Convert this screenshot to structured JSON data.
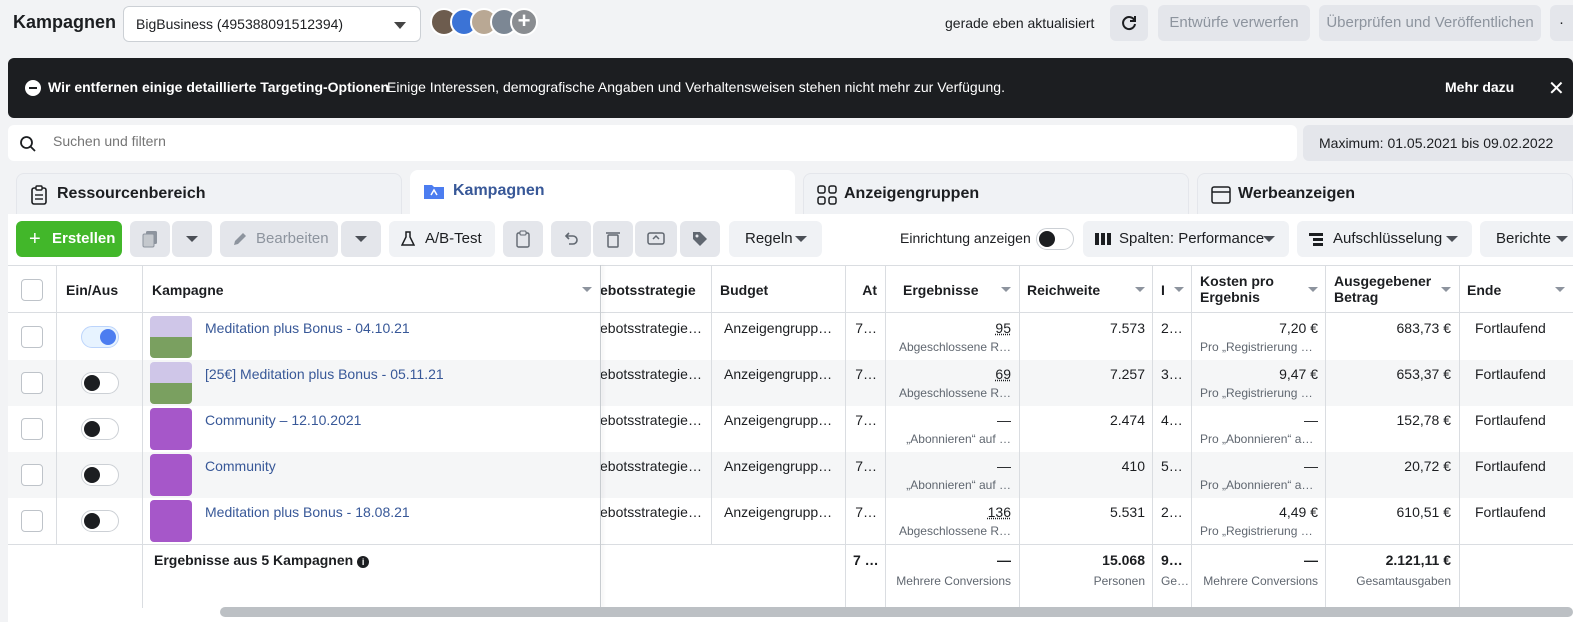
{
  "header": {
    "title": "Kampagnen",
    "account": "BigBusiness (495388091512394)",
    "updated": "gerade eben aktualisiert",
    "discard": "Entwürfe verwerfen",
    "review": "Überprüfen und Veröffentlichen"
  },
  "banner": {
    "title": "Wir entfernen einige detaillierte Targeting-Optionen",
    "text": "Einige Interessen, demografische Angaben und Verhaltensweisen stehen nicht mehr zur Verfügung.",
    "more": "Mehr dazu"
  },
  "search": {
    "placeholder": "Suchen und filtern"
  },
  "daterange": "Maximum: 01.05.2021 bis 09.02.2022",
  "tabs": [
    {
      "label": "Ressourcenbereich"
    },
    {
      "label": "Kampagnen"
    },
    {
      "label": "Anzeigengruppen"
    },
    {
      "label": "Werbeanzeigen"
    }
  ],
  "toolbar": {
    "create": "Erstellen",
    "edit": "Bearbeiten",
    "abtest": "A/B-Test",
    "rules": "Regeln",
    "setup": "Einrichtung anzeigen",
    "columns": "Spalten: Performance",
    "breakdown": "Aufschlüsselung",
    "reports": "Berichte"
  },
  "columns": {
    "onoff": "Ein/Aus",
    "campaign": "Kampagne",
    "bid": "ebotsstrategie",
    "budget": "Budget",
    "at": "At",
    "results": "Ergebnisse",
    "reach": "Reichweite",
    "i": "I",
    "cost": "Kosten pro Ergebnis",
    "spent": "Ausgegebener Betrag",
    "end": "Ende"
  },
  "rows": [
    {
      "on": true,
      "name": "Meditation plus Bonus - 04.10.21",
      "bid": "ebotsstrategie…",
      "budget": "Anzeigengrupp…",
      "at": "7…",
      "result": "95",
      "result_sub": "Abgeschlossene R…",
      "reach": "7.573",
      "i": "2…",
      "cost": "7,20 €",
      "cost_sub": "Pro „Registrierung …",
      "spent": "683,73 €",
      "end": "Fortlaufend"
    },
    {
      "on": false,
      "name": "[25€] Meditation plus Bonus - 05.11.21",
      "bid": "ebotsstrategie…",
      "budget": "Anzeigengrupp…",
      "at": "7…",
      "result": "69",
      "result_sub": "Abgeschlossene R…",
      "reach": "7.257",
      "i": "3…",
      "cost": "9,47 €",
      "cost_sub": "Pro „Registrierung …",
      "spent": "653,37 €",
      "end": "Fortlaufend"
    },
    {
      "on": false,
      "name": "Community – 12.10.2021",
      "bid": "ebotsstrategie…",
      "budget": "Anzeigengrupp…",
      "at": "7…",
      "result": "—",
      "result_sub": "„Abonnieren“ auf …",
      "reach": "2.474",
      "i": "4…",
      "cost": "—",
      "cost_sub": "Pro „Abonnieren“ a…",
      "spent": "152,78 €",
      "end": "Fortlaufend"
    },
    {
      "on": false,
      "name": "Community",
      "bid": "ebotsstrategie…",
      "budget": "Anzeigengrupp…",
      "at": "7…",
      "result": "—",
      "result_sub": "„Abonnieren“ auf …",
      "reach": "410",
      "i": "5…",
      "cost": "—",
      "cost_sub": "Pro „Abonnieren“ a…",
      "spent": "20,72 €",
      "end": "Fortlaufend"
    },
    {
      "on": false,
      "name": "Meditation plus Bonus - 18.08.21",
      "bid": "ebotsstrategie…",
      "budget": "Anzeigengrupp…",
      "at": "7…",
      "result": "136",
      "result_sub": "Abgeschlossene R…",
      "reach": "5.531",
      "i": "2…",
      "cost": "4,49 €",
      "cost_sub": "Pro „Registrierung …",
      "spent": "610,51 €",
      "end": "Fortlaufend"
    }
  ],
  "totals": {
    "label": "Ergebnisse aus 5 Kampagnen",
    "at": "7 …",
    "results": "—",
    "results_sub": "Mehrere Conversions",
    "reach": "15.068",
    "reach_sub": "Personen",
    "i": "9…",
    "i_sub": "Ge…",
    "cost": "—",
    "cost_sub": "Mehrere Conversions",
    "spent": "2.121,11 €",
    "spent_sub": "Gesamtausgaben"
  },
  "colors": {
    "primary": "#385898",
    "create": "#42b72a",
    "banner": "#1c1e21"
  }
}
